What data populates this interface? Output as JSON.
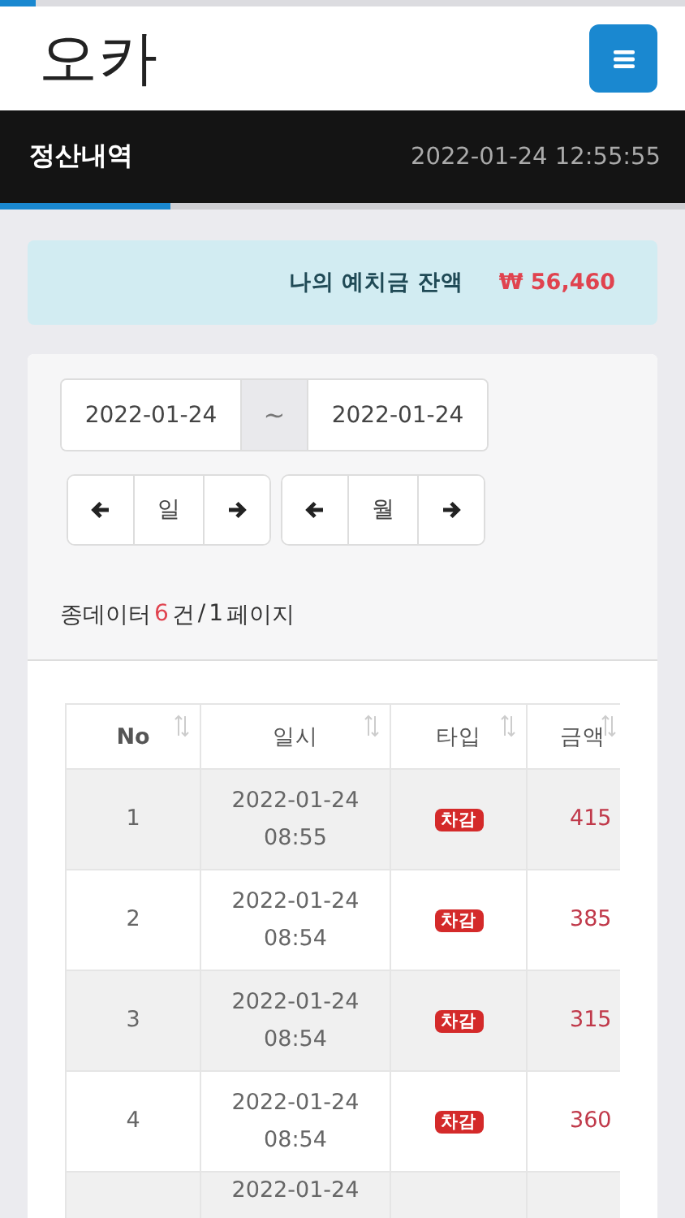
{
  "logo": "오카",
  "page_title": "정산내역",
  "clock": "2022-01-24 12:55:55",
  "balance": {
    "label": "나의 예치금 잔액",
    "amount": "₩ 56,460"
  },
  "date_range": {
    "start": "2022-01-24",
    "separator": "~",
    "end": "2022-01-24"
  },
  "steppers": [
    {
      "label": "일"
    },
    {
      "label": "월"
    }
  ],
  "summary_parts": {
    "prefix": "종데이터",
    "count": "6",
    "middle": "건",
    "slash": "/",
    "pages": "1",
    "suffix": "페이지"
  },
  "table": {
    "columns": [
      "No",
      "일시",
      "타입",
      "금액"
    ],
    "rows": [
      {
        "no": "1",
        "date": "2022-01-24",
        "time": "08:55",
        "type": "차감",
        "amount": "415"
      },
      {
        "no": "2",
        "date": "2022-01-24",
        "time": "08:54",
        "type": "차감",
        "amount": "385"
      },
      {
        "no": "3",
        "date": "2022-01-24",
        "time": "08:54",
        "type": "차감",
        "amount": "315"
      },
      {
        "no": "4",
        "date": "2022-01-24",
        "time": "08:54",
        "type": "차감",
        "amount": "360"
      },
      {
        "date": "2022-01-24"
      }
    ]
  }
}
